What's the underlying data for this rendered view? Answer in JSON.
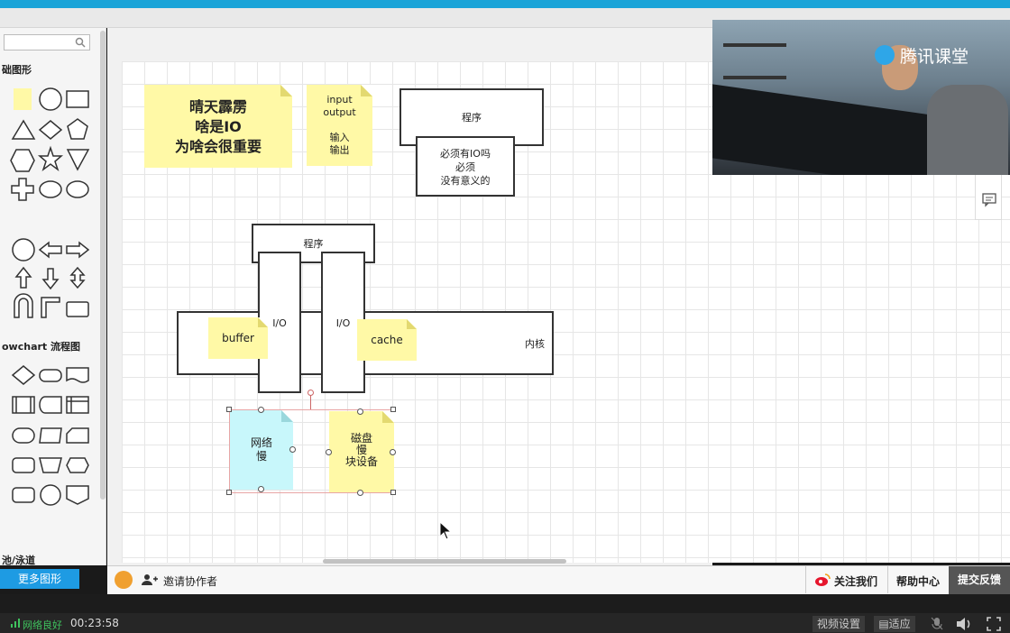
{
  "sidebar": {
    "search_placeholder": "",
    "section_basic": "础图形",
    "section_flowchart": "owchart 流程图",
    "section_swimlane": "池/泳道",
    "more_shapes": "更多图形"
  },
  "canvas": {
    "note_title_lines": [
      "晴天霹雳",
      "啥是IO",
      "为啥会很重要"
    ],
    "note_io": [
      "input",
      "output",
      "",
      "输入",
      "输出"
    ],
    "program_top": "程序",
    "must_io": [
      "必须有IO吗",
      "必须",
      "没有意义的"
    ],
    "program_mid": "程序",
    "io_left": "I/O",
    "io_right": "I/O",
    "kernel": "内核",
    "buffer": "buffer",
    "cache": "cache",
    "network": [
      "网络",
      "慢"
    ],
    "disk": [
      "磁盘",
      "慢",
      "块设备"
    ]
  },
  "bottombar": {
    "invite": "邀请协作者",
    "follow": "关注我们",
    "help": "帮助中心",
    "feedback": "提交反馈"
  },
  "video": {
    "brand": "腾讯课堂"
  },
  "status": {
    "network": "网络良好",
    "time": "00:23:58",
    "video_settings": "视频设置",
    "fit": "适应"
  },
  "colors": {
    "accent": "#1aa4d8",
    "note_yellow": "#fff9a6",
    "note_cyan": "#c8f7fb",
    "feedback_bg": "#555555"
  }
}
